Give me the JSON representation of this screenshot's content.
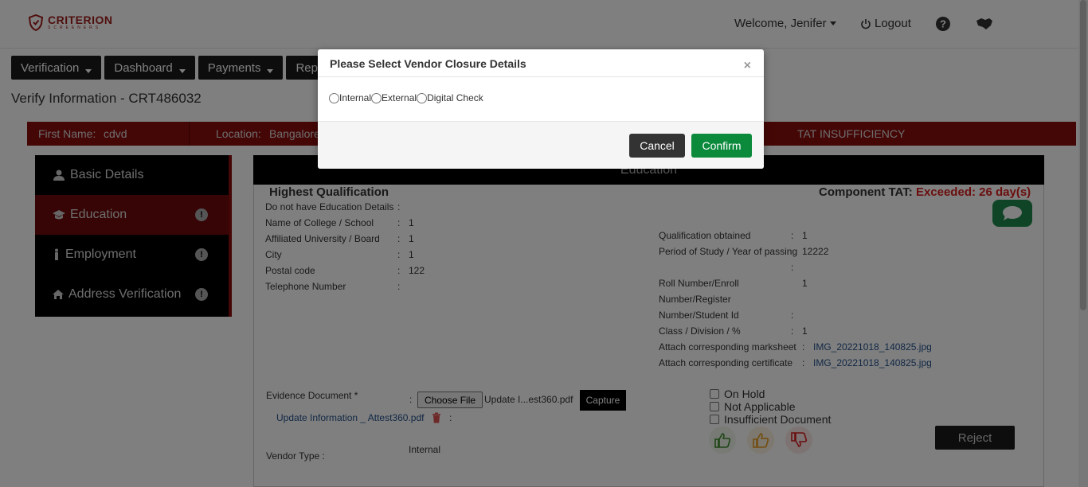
{
  "header": {
    "logo_main": "CRITERION",
    "logo_sub": "SCREENERS",
    "welcome": "Welcome, Jenifer",
    "logout": "Logout"
  },
  "nav": [
    "Verification",
    "Dashboard",
    "Payments",
    "Repo"
  ],
  "page_title": "Verify Information - CRT486032",
  "infobar": {
    "first_name_label": "First Name:",
    "first_name_value": "cdvd",
    "location_label": "Location:",
    "location_value": "Bangalore",
    "status": "TAT INSUFFICIENCY"
  },
  "sidebar": [
    {
      "label": "Basic Details"
    },
    {
      "label": "Education"
    },
    {
      "label": "Employment"
    },
    {
      "label": "Address Verification"
    }
  ],
  "panel": {
    "heading": "Education",
    "section_title": "Highest Qualification",
    "tat_label": "Component TAT:",
    "tat_value": "Exceeded: 26 day(s)"
  },
  "left_fields": [
    {
      "label": "Do not have Education Details",
      "value": ""
    },
    {
      "label": "Name of College / School",
      "value": "1"
    },
    {
      "label": "Affiliated University / Board",
      "value": "1"
    },
    {
      "label": "City",
      "value": "1"
    },
    {
      "label": "Postal code",
      "value": "122"
    },
    {
      "label": "Telephone Number",
      "value": ""
    }
  ],
  "right_fields": {
    "qualification_label": "Qualification obtained",
    "qualification_value": "1",
    "period_label": "Period of Study / Year of passing",
    "period_value": "12222",
    "roll_label_1": "Roll Number/Enroll",
    "roll_value": "1",
    "roll_label_2": "Number/Register",
    "roll_label_3": "Number/Student Id",
    "class_label": "Class / Division / %",
    "class_value": "1",
    "marksheet_label": "Attach corresponding marksheet",
    "marksheet_value": "IMG_20221018_140825.jpg",
    "certificate_label": "Attach corresponding certificate",
    "certificate_value": "IMG_20221018_140825.jpg"
  },
  "evidence": {
    "label": "Evidence Document *",
    "choose_file": "Choose File",
    "file_name": "Update I...est360.pdf",
    "capture": "Capture",
    "uploaded": "Update Information _ Attest360.pdf"
  },
  "vendor": {
    "label": "Vendor Type :",
    "value": "Internal"
  },
  "checks": [
    "On Hold",
    "Not Applicable",
    "Insufficient Document"
  ],
  "reject": "Reject",
  "modal": {
    "title": "Please Select Vendor Closure Details",
    "close": "×",
    "options": [
      "Internal",
      "External",
      "Digital Check"
    ],
    "cancel": "Cancel",
    "confirm": "Confirm"
  }
}
